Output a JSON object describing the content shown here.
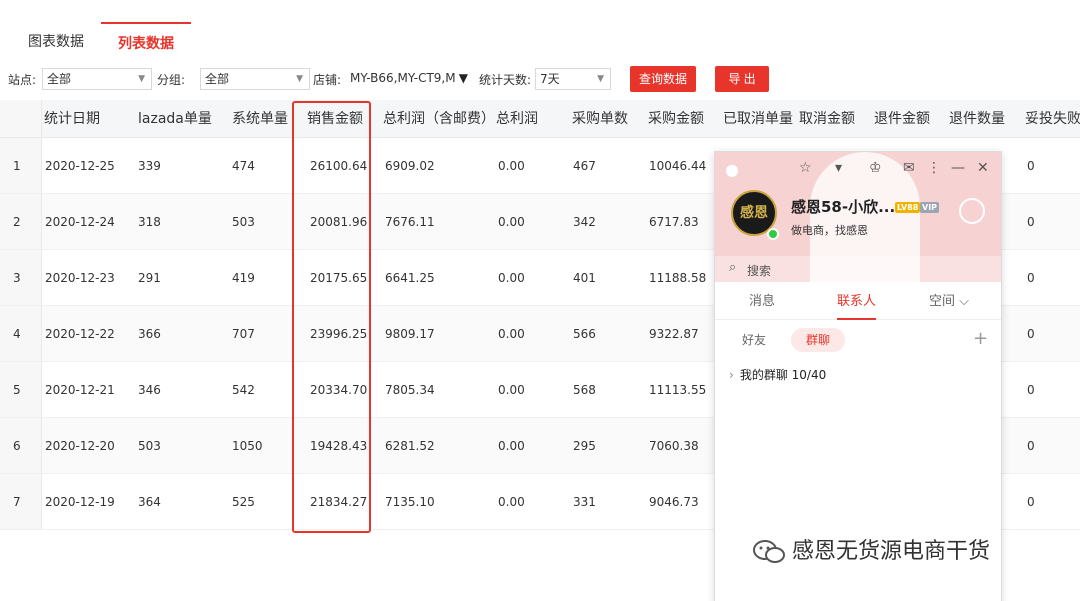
{
  "tabs": [
    "图表数据",
    "列表数据"
  ],
  "filters": {
    "site_label": "站点:",
    "site_value": "全部",
    "group_label": "分组:",
    "group_value": "全部",
    "shop_label": "店铺:",
    "shop_value": "MY-B66,MY-CT9,M",
    "days_label": "统计天数:",
    "days_value": "7天",
    "query_button": "查询数据",
    "export_button": "导 出"
  },
  "table": {
    "headers": [
      "统计日期",
      "lazada单量",
      "系统单量",
      "销售金额",
      "总利润（含邮费）",
      "总利润",
      "采购单数",
      "采购金额",
      "已取消单量",
      "取消金额",
      "退件金额",
      "退件数量",
      "妥投失败"
    ],
    "rows": [
      {
        "index": "1",
        "date": "2020-12-25",
        "lazada": "339",
        "system": "474",
        "sales": "26100.64",
        "profit_shipping": "6909.02",
        "profit": "0.00",
        "purchase_count": "467",
        "purchase_amount": "10046.44",
        "last": "0"
      },
      {
        "index": "2",
        "date": "2020-12-24",
        "lazada": "318",
        "system": "503",
        "sales": "20081.96",
        "profit_shipping": "7676.11",
        "profit": "0.00",
        "purchase_count": "342",
        "purchase_amount": "6717.83",
        "last": "0"
      },
      {
        "index": "3",
        "date": "2020-12-23",
        "lazada": "291",
        "system": "419",
        "sales": "20175.65",
        "profit_shipping": "6641.25",
        "profit": "0.00",
        "purchase_count": "401",
        "purchase_amount": "11188.58",
        "last": "0"
      },
      {
        "index": "4",
        "date": "2020-12-22",
        "lazada": "366",
        "system": "707",
        "sales": "23996.25",
        "profit_shipping": "9809.17",
        "profit": "0.00",
        "purchase_count": "566",
        "purchase_amount": "9322.87",
        "last": "0"
      },
      {
        "index": "5",
        "date": "2020-12-21",
        "lazada": "346",
        "system": "542",
        "sales": "20334.70",
        "profit_shipping": "7805.34",
        "profit": "0.00",
        "purchase_count": "568",
        "purchase_amount": "11113.55",
        "last": "0"
      },
      {
        "index": "6",
        "date": "2020-12-20",
        "lazada": "503",
        "system": "1050",
        "sales": "19428.43",
        "profit_shipping": "6281.52",
        "profit": "0.00",
        "purchase_count": "295",
        "purchase_amount": "7060.38",
        "last": "0"
      },
      {
        "index": "7",
        "date": "2020-12-19",
        "lazada": "364",
        "system": "525",
        "sales": "21834.27",
        "profit_shipping": "7135.10",
        "profit": "0.00",
        "purchase_count": "331",
        "purchase_amount": "9046.73",
        "last": "0"
      }
    ]
  },
  "qq_panel": {
    "avatar_text": "感恩",
    "nickname": "感恩58-小欣...",
    "badge_level": "LV88",
    "badge_vip": "VIP",
    "signature": "做电商，找感恩",
    "search_placeholder": "搜索",
    "nav_tabs": [
      "消息",
      "联系人",
      "空间 ⌵"
    ],
    "sub_tabs": [
      "好友",
      "群聊"
    ],
    "plus": "+",
    "group_item": "我的群聊 10/40"
  },
  "watermark": "感恩无货源电商干货",
  "colors": {
    "accent": "#e8352b",
    "qq_header": "#f7d2d2"
  }
}
